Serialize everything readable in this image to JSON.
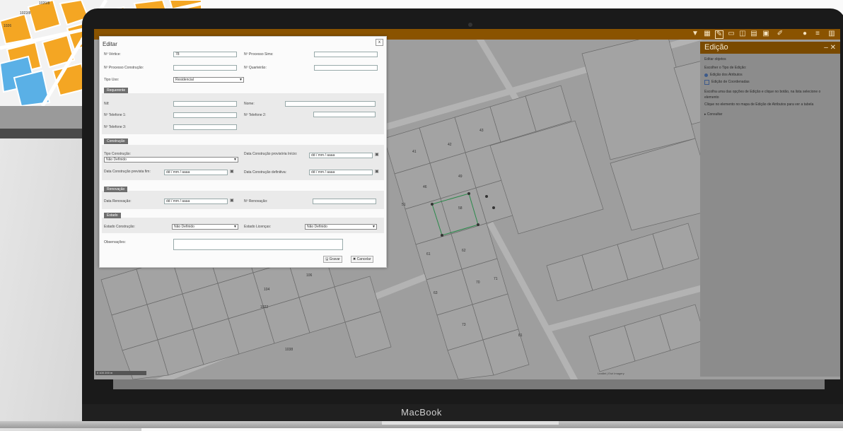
{
  "background_laptop": {
    "map_labels": [
      "1020/8",
      "1022/8",
      "1026"
    ]
  },
  "laptop": {
    "brand": "MacBook"
  },
  "toolbar": {
    "icons": [
      "filter-icon",
      "layers-icon",
      "edit-mode-icon",
      "measure-icon",
      "select-icon",
      "table-icon",
      "print-icon",
      "pencil-icon",
      "user-icon",
      "menu-icon"
    ]
  },
  "panel": {
    "title": "Edição",
    "subtitle": "Editar objetos",
    "prompt": "Escolher o Tipo de Edição:",
    "options": [
      "Edição dos Atributos",
      "Edição de Coordenadas"
    ],
    "notes": [
      "Escolha uma das opções de Edição e clique no botão, na lista selecione o elemento",
      "Clique no elemento no mapa de Edição de Atributos para ver a tabela"
    ],
    "expander": "Consultar"
  },
  "dialog": {
    "title": "Editar",
    "close": "x",
    "fields": {
      "n_vertice": {
        "label": "Nº Vértice:",
        "value": "78"
      },
      "n_processo_sims": {
        "label": "Nº Processo Sims:",
        "value": ""
      },
      "n_processo_construcao": {
        "label": "Nº Processo Construção:",
        "value": ""
      },
      "n_quarteirao": {
        "label": "Nº Quarteirão:",
        "value": ""
      },
      "tipo_uso": {
        "label": "Tipo Uso:",
        "value": "Residencial"
      }
    },
    "sections": {
      "requerente": {
        "title": "Requerente",
        "nif": "Nif:",
        "nome": "Nome:",
        "tel1": "Nº Telefone 1:",
        "tel2": "Nº Telefone 2:",
        "tel3": "Nº Telefone 3:"
      },
      "construcao": {
        "title": "Construção",
        "tipo": "Tipo Construção:",
        "tipo_value": "Não Definido",
        "data_inicio": "Data Construção provisória Início:",
        "data_prevista": "Data Construção prevista fim:",
        "data_definitiva": "Data Construção definitiva:",
        "date_placeholder": "dd / mm / aaaa"
      },
      "renovacao": {
        "title": "Renovação",
        "data": "Data Renovação:",
        "numero": "Nº Renovação:",
        "date_placeholder": "dd / mm / aaaa"
      },
      "estado": {
        "title": "Estado",
        "estado_construcao": "Estado Construção:",
        "estado_value": "Não Definido",
        "situacao": "Estado Licenças:",
        "situacao_value": "Não Definido"
      }
    },
    "observacoes": "Observações:",
    "buttons": {
      "gravar": "Gravar",
      "cancelar": "Cancelar"
    }
  },
  "map": {
    "parcel_labels": [
      "41",
      "42",
      "43",
      "46",
      "49",
      "51",
      "58",
      "61",
      "62",
      "63",
      "70",
      "73",
      "81",
      "104",
      "106",
      "1022",
      "1038",
      "71"
    ],
    "scale_text": "0 100 200 m",
    "attribution": "Leaflet | Esri Imagery"
  }
}
